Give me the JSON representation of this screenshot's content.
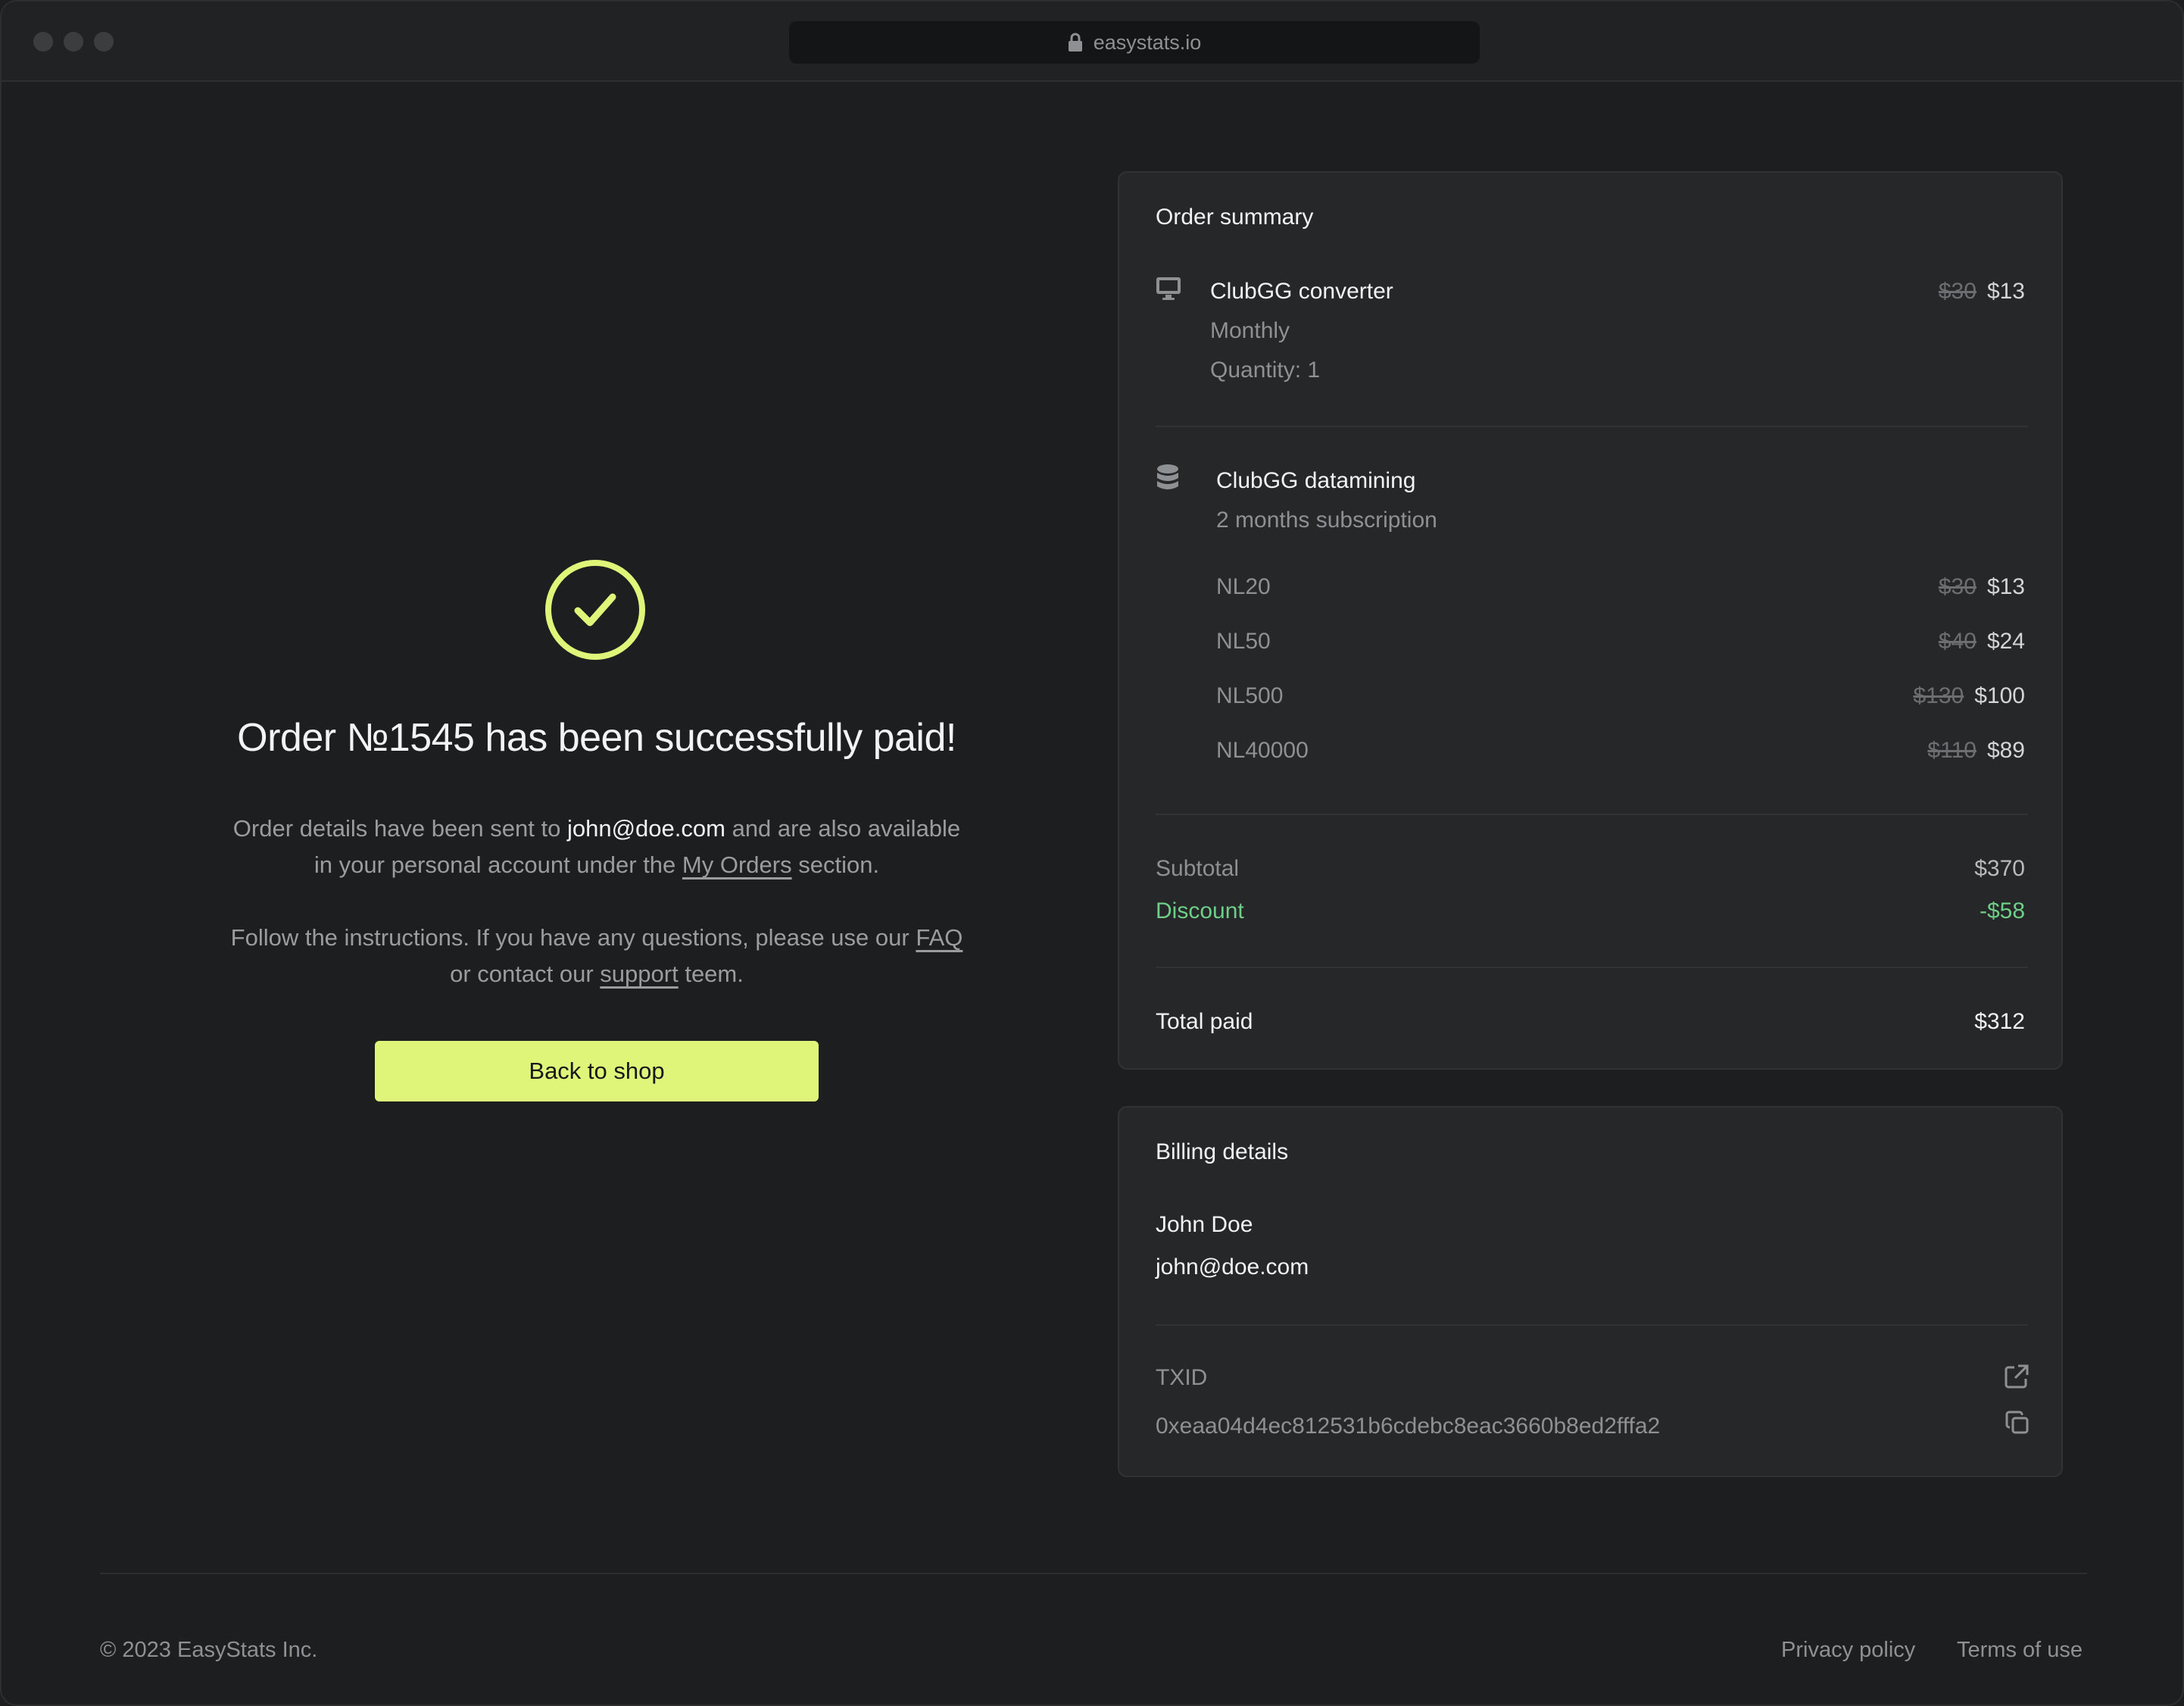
{
  "browser": {
    "url": "easystats.io"
  },
  "confirmation": {
    "headline": "Order №1545 has been successfully paid!",
    "p1_pre": "Order details have been sent to",
    "p1_email": "john@doe.com",
    "p1_post": "and are also available",
    "p1_line2_pre": "in your personal account under the",
    "p1_link": "My Orders",
    "p1_line2_post": "section.",
    "p2_pre": "Follow the instructions. If you have any questions, please use our",
    "p2_link1": "FAQ",
    "p2_line2_pre": "or contact our",
    "p2_link2": "support",
    "p2_line2_post": "teem.",
    "button": "Back to shop"
  },
  "order_summary": {
    "title": "Order summary",
    "product1": {
      "icon": "monitor-icon",
      "name": "ClubGG converter",
      "plan": "Monthly",
      "quantity": "Quantity: 1",
      "old_price": "$30",
      "price": "$13"
    },
    "product2": {
      "icon": "database-icon",
      "name": "ClubGG datamining",
      "plan": "2 months subscription",
      "lines": [
        {
          "name": "NL20",
          "old_price": "$30",
          "price": "$13"
        },
        {
          "name": "NL50",
          "old_price": "$40",
          "price": "$24"
        },
        {
          "name": "NL500",
          "old_price": "$130",
          "price": "$100"
        },
        {
          "name": "NL40000",
          "old_price": "$110",
          "price": "$89"
        }
      ]
    },
    "subtotal_label": "Subtotal",
    "subtotal": "$370",
    "discount_label": "Discount",
    "discount": "-$58",
    "total_label": "Total paid",
    "total": "$312"
  },
  "billing": {
    "title": "Billing details",
    "name": "John Doe",
    "email": "john@doe.com",
    "txid_label": "TXID",
    "txid": "0xeaa04d4ec812531b6cdebc8eac3660b8ed2fffa2"
  },
  "footer": {
    "copyright": "© 2023 EasyStats Inc.",
    "privacy": "Privacy policy",
    "terms": "Terms of use"
  },
  "colors": {
    "accent": "#dff57a",
    "background": "#1c1e1f",
    "card": "#262729",
    "discount": "#6fce87"
  }
}
